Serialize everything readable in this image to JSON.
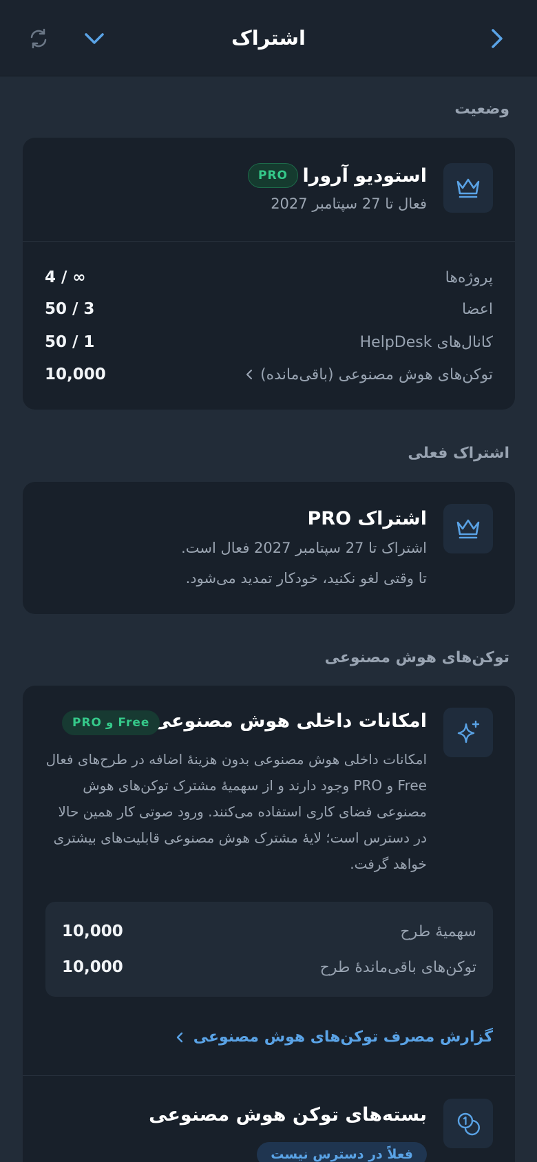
{
  "header": {
    "title": "اشتراک"
  },
  "sections": {
    "status": "وضعیت",
    "current": "اشتراک فعلی",
    "ai_tokens": "توکن‌های هوش مصنوعی"
  },
  "workspace": {
    "name": "استودیو آرورا",
    "badge": "PRO",
    "active_until": "فعال تا 27 سپتامبر 2027",
    "stats": [
      {
        "label": "پروژه‌ها",
        "value": "4 / ∞"
      },
      {
        "label": "اعضا",
        "value": "50 / 3"
      },
      {
        "label": "کانال‌های HelpDesk",
        "value": "50 / 1"
      },
      {
        "label": "توکن‌های هوش مصنوعی (باقی‌مانده)",
        "value": "10,000"
      }
    ]
  },
  "subscription": {
    "title": "اشتراک PRO",
    "line1": "اشتراک تا 27 سپتامبر 2027 فعال است.",
    "line2": "تا وقتی لغو نکنید، خودکار تمدید می‌شود."
  },
  "ai": {
    "title": "امکانات داخلی هوش مصنوعی",
    "badge": "Free و PRO",
    "description": "امکانات داخلی هوش مصنوعی بدون هزینهٔ اضافه در طرح‌های فعال Free و PRO وجود دارند و از سهمیهٔ مشترک توکن‌های هوش مصنوعی فضای کاری استفاده می‌کنند. ورود صوتی کار همین حالا در دسترس است؛ لایهٔ مشترک هوش مصنوعی قابلیت‌های بیشتری خواهد گرفت.",
    "quota_label": "سهمیهٔ طرح",
    "quota_value": "10,000",
    "remaining_label": "توکن‌های باقی‌ماندهٔ طرح",
    "remaining_value": "10,000",
    "report_link": "گزارش مصرف توکن‌های هوش مصنوعی"
  },
  "packages": {
    "title": "بسته‌های توکن هوش مصنوعی",
    "badge": "فعلاً در دسترس نیست"
  },
  "colors": {
    "background": "#222c38",
    "card": "#18202a",
    "accent": "#5aa3e6",
    "pro_green": "#35c98a"
  }
}
